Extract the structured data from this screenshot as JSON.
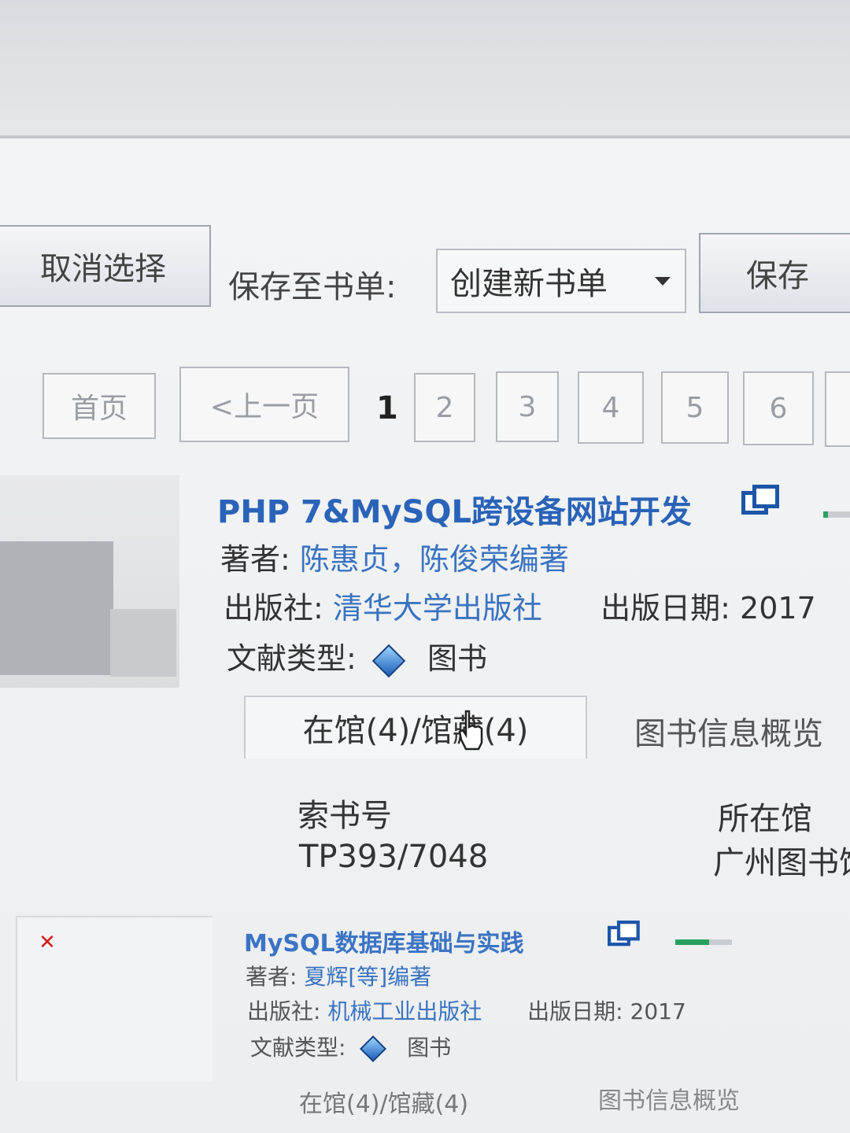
{
  "toolbar": {
    "cancel_select": "取消选择",
    "save_to_list_label": "保存至书单:",
    "booklist_select": "创建新书单",
    "save_button": "保存"
  },
  "pagination": {
    "first": "首页",
    "prev": "<上一页",
    "current": "1",
    "pages": [
      "2",
      "3",
      "4",
      "5",
      "6"
    ]
  },
  "results": [
    {
      "title": "PHP 7&MySQL跨设备网站开发",
      "author_label": "著者:",
      "author": "陈惠贞，陈俊荣编著",
      "publisher_label": "出版社:",
      "publisher": "清华大学出版社",
      "pubdate_label": "出版日期:",
      "pubdate": "2017",
      "type_label": "文献类型:",
      "type": "图书",
      "tab_holdings": "在馆(4)/馆藏(4)",
      "tab_info": "图书信息概览",
      "col_callno": "索书号",
      "col_library": "所在馆",
      "callno": "TP393/7048",
      "library": "广州图书馆"
    },
    {
      "title": "MySQL数据库基础与实践",
      "author_label": "著者:",
      "author": "夏辉[等]编著",
      "publisher_label": "出版社:",
      "publisher": "机械工业出版社",
      "pubdate_label": "出版日期:",
      "pubdate": "2017",
      "type_label": "文献类型:",
      "type": "图书",
      "tab_holdings": "在馆(4)/馆藏(4)",
      "tab_info": "图书信息概览"
    }
  ],
  "colors": {
    "title_link": "#2a63b8",
    "meta_link": "#3a73c0",
    "availability_bar": "#2aa060"
  },
  "availability": [
    0.15,
    0.6
  ]
}
